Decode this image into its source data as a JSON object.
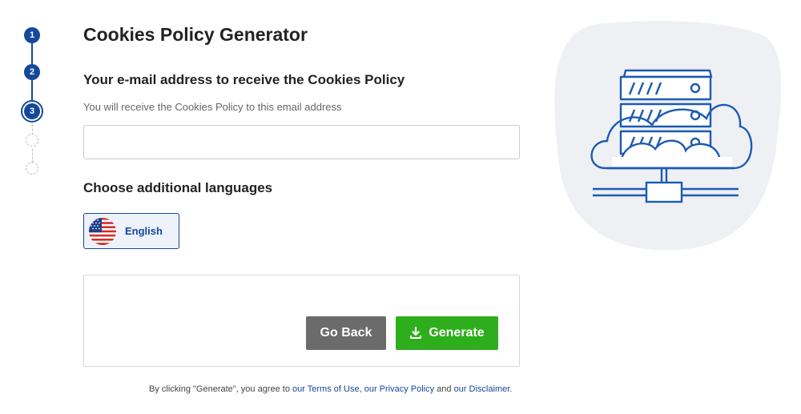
{
  "stepper": {
    "steps": [
      {
        "label": "1",
        "state": "done"
      },
      {
        "label": "2",
        "state": "done"
      },
      {
        "label": "3",
        "state": "active"
      },
      {
        "label": "",
        "state": "future"
      },
      {
        "label": "",
        "state": "future"
      }
    ]
  },
  "page": {
    "title": "Cookies Policy Generator"
  },
  "email": {
    "heading": "Your e-mail address to receive the Cookies Policy",
    "help": "You will receive the Cookies Policy to this email address",
    "value": "",
    "placeholder": ""
  },
  "languages": {
    "heading": "Choose additional languages",
    "items": [
      {
        "label": "English",
        "flag": "us-flag-icon",
        "selected": true
      }
    ]
  },
  "actions": {
    "back_label": "Go Back",
    "generate_label": "Generate",
    "generate_icon": "download-icon"
  },
  "terms": {
    "prefix": "By clicking \"Generate\", you agree to ",
    "terms_link": "our Terms of Use",
    "sep1": ", ",
    "privacy_link": "our Privacy Policy",
    "sep2": " and ",
    "disclaimer_link": "our Disclaimer",
    "suffix": "."
  },
  "illustration": {
    "icon": "cloud-server-icon"
  },
  "colors": {
    "primary": "#14489b",
    "generate": "#2fae1d",
    "back": "#6b6b6b",
    "blob": "#eef0f4"
  }
}
